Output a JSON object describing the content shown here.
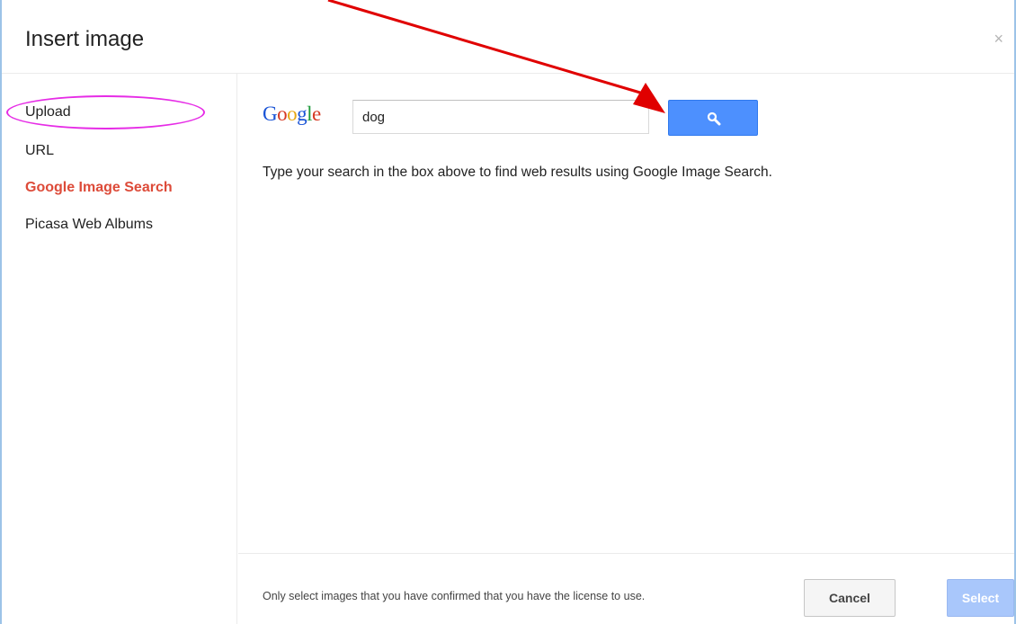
{
  "dialog": {
    "title": "Insert image",
    "close_glyph": "×"
  },
  "sidebar": {
    "items": [
      {
        "label": "Upload"
      },
      {
        "label": "URL"
      },
      {
        "label": "Google Image Search",
        "active": true
      },
      {
        "label": "Picasa Web Albums"
      }
    ]
  },
  "search": {
    "logo_letters": [
      "G",
      "o",
      "o",
      "g",
      "l",
      "e"
    ],
    "query": "dog",
    "button_icon": "magnifier-icon",
    "hint": "Type your search in the box above to find web results using Google Image Search."
  },
  "footer": {
    "license_note": "Only select images that you have confirmed that you have the license to use.",
    "cancel_label": "Cancel",
    "select_label": "Select"
  },
  "colors": {
    "accent_blue": "#4d90fe",
    "active_red": "#dd4b39",
    "annotation_red": "#e00000",
    "annotation_magenta": "#e62ce6"
  }
}
